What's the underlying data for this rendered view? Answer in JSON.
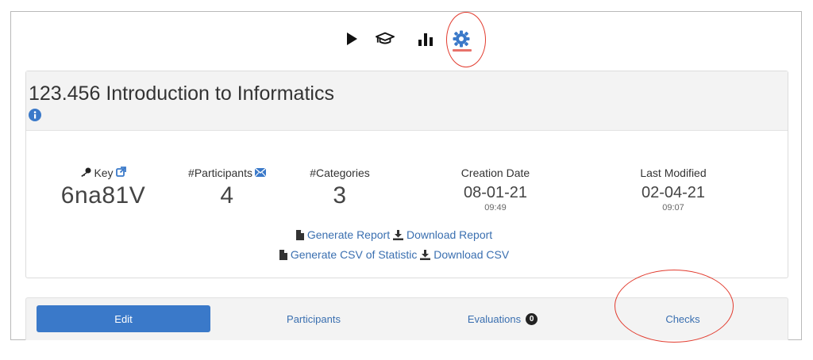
{
  "nav": {
    "icons": [
      "play-icon",
      "graduation-cap-icon",
      "bar-chart-icon",
      "gear-icon"
    ],
    "active": "gear-icon",
    "accent_color": "#e8726a"
  },
  "course": {
    "title": "123.456 Introduction to Informatics"
  },
  "stats": {
    "key_label": "Key",
    "key_value": "6na81V",
    "participants_label": "#Participants",
    "participants_value": "4",
    "categories_label": "#Categories",
    "categories_value": "3",
    "creation_label": "Creation Date",
    "creation_date": "08-01-21",
    "creation_time": "09:49",
    "modified_label": "Last Modified",
    "modified_date": "02-04-21",
    "modified_time": "09:07"
  },
  "actions": {
    "generate_report": "Generate Report",
    "download_report": "Download Report",
    "generate_csv": "Generate CSV of Statistic",
    "download_csv": "Download CSV"
  },
  "tabs": {
    "edit": "Edit",
    "participants": "Participants",
    "evaluations": "Evaluations",
    "evaluations_count": "0",
    "checks": "Checks"
  },
  "colors": {
    "primary": "#3a79c9",
    "link": "#3a6fb0",
    "annotation": "#e23b2e"
  }
}
